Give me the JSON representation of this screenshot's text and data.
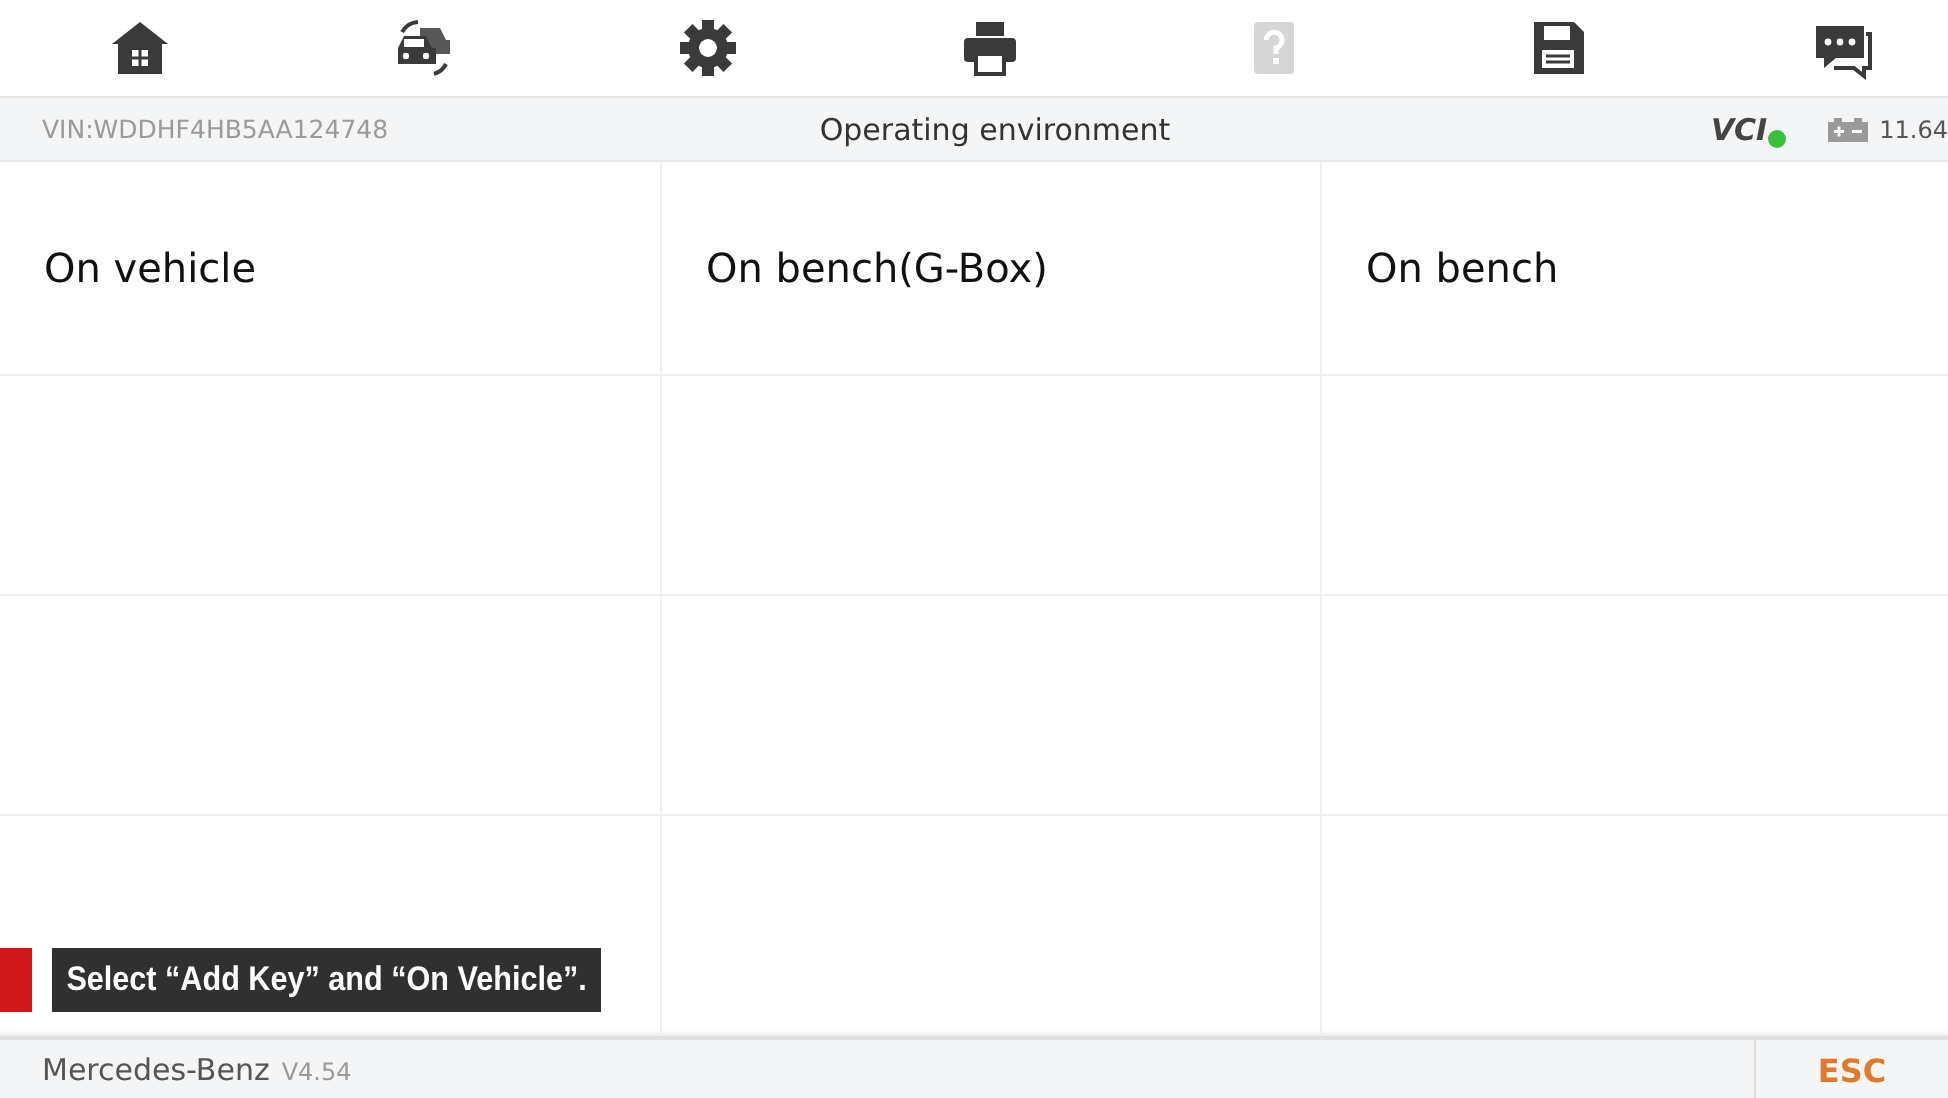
{
  "toolbar": [
    {
      "kind": "home",
      "disabled": false
    },
    {
      "kind": "cars",
      "disabled": false
    },
    {
      "kind": "gear",
      "disabled": false
    },
    {
      "kind": "printer",
      "disabled": false
    },
    {
      "kind": "help",
      "disabled": true
    },
    {
      "kind": "save",
      "disabled": false
    },
    {
      "kind": "chat",
      "disabled": false
    }
  ],
  "info_bar": {
    "vin": "VIN:WDDHF4HB5AA124748",
    "title": "Operating environment",
    "vci": {
      "label": "VCI",
      "connected": true
    },
    "battery": "11.64"
  },
  "options": [
    {
      "label": "On vehicle"
    },
    {
      "label": "On bench(G-Box)"
    },
    {
      "label": "On bench"
    }
  ],
  "caption": "Select “Add Key” and “On Vehicle”.",
  "footer": {
    "brand": "Mercedes-Benz",
    "version": "V4.54",
    "esc": "ESC"
  }
}
